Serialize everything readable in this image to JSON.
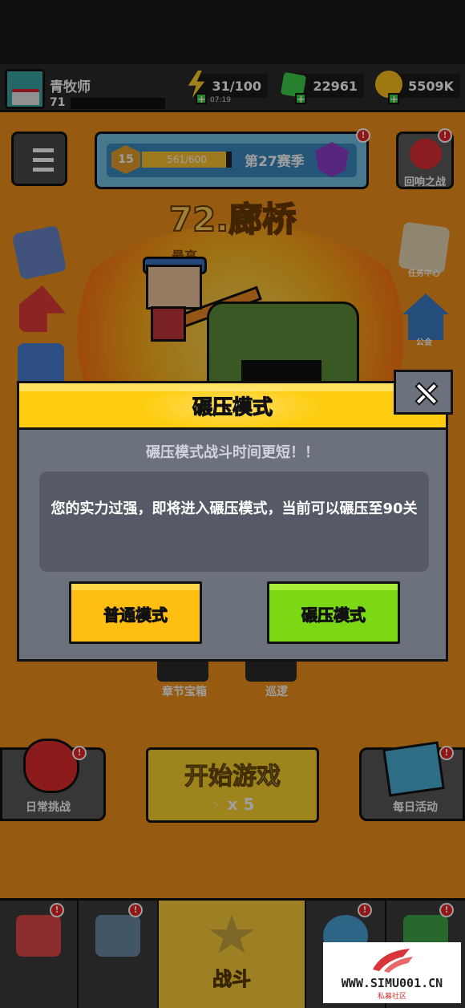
{
  "topbar": {
    "player_name": "青牧师",
    "player_level": "71",
    "energy": "31/100",
    "energy_timer": "07:19",
    "gems": "22961",
    "gold": "5509K"
  },
  "season": {
    "level": "15",
    "progress_text": "561/600",
    "progress_fraction": 0.935,
    "name": "第27赛季"
  },
  "echo_battle": {
    "label": "回响之战",
    "badge": "!"
  },
  "chapter": {
    "title": "72.廊桥",
    "best_record": "最高"
  },
  "side_icons": {
    "task_center": "任务中心",
    "guild": "公会"
  },
  "secondary": {
    "chapter_chest": "章节宝箱",
    "patrol": "巡逻"
  },
  "daily_challenge": {
    "label": "日常挑战",
    "badge": "!"
  },
  "daily_activity": {
    "label": "每日活动",
    "badge": "!"
  },
  "start_button": {
    "title": "开始游戏",
    "cost": "x 5"
  },
  "bottom_nav": {
    "battle_label": "战斗",
    "badges": [
      "!",
      "!",
      "!",
      "!"
    ]
  },
  "modal": {
    "title": "碾压模式",
    "subtitle": "碾压模式战斗时间更短！！",
    "message": "您的实力过强，即将进入碾压模式，当前可以碾压至90关",
    "normal_button": "普通模式",
    "crush_button": "碾压模式"
  },
  "watermark": {
    "text": "WWW.SIMU001.CN",
    "subtext": "私募社区"
  },
  "colors": {
    "modal_header": "#ffcd10",
    "modal_body": "#6b717d",
    "normal_button": "#ffbe12",
    "crush_button": "#7cd814"
  }
}
